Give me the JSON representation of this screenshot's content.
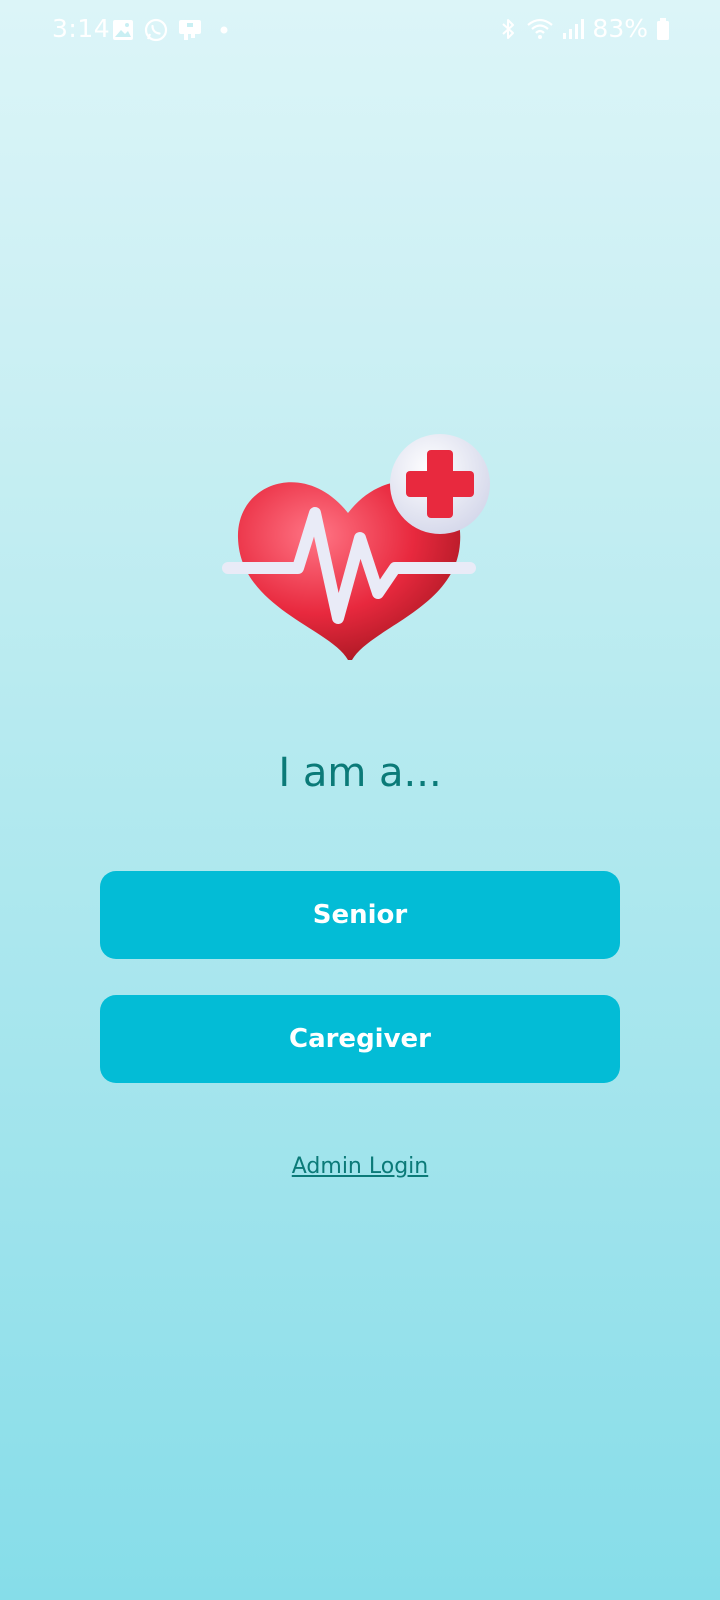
{
  "status_bar": {
    "time": "3:14",
    "battery": "83%",
    "left_icons": [
      "gallery-icon",
      "whatsapp-icon",
      "app-notification-icon",
      "dot-icon"
    ],
    "right_icons": [
      "bluetooth-icon",
      "wifi-icon",
      "signal-icon",
      "battery-icon"
    ]
  },
  "logo": {
    "icon": "heart-pulse-medical-icon",
    "heart_color": "#e8293e",
    "cross_color": "#e8293e"
  },
  "heading": "I am a...",
  "buttons": {
    "senior": "Senior",
    "caregiver": "Caregiver"
  },
  "admin_link": "Admin Login",
  "colors": {
    "accent": "#03bcd6",
    "heading_text": "#0b7a78"
  }
}
